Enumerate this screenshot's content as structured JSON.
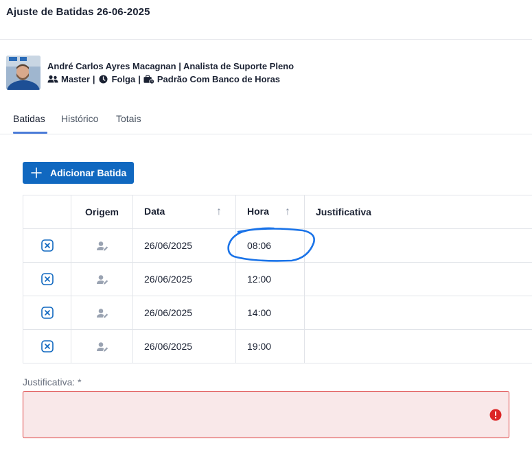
{
  "page": {
    "title": "Ajuste de Batidas 26-06-2025"
  },
  "user": {
    "name_role": "André Carlos Ayres Macagnan | Analista de Suporte Pleno",
    "group": "Master",
    "schedule": "Folga",
    "bank": "Padrão Com Banco de Horas",
    "separator": "|",
    "icons": [
      "users-icon",
      "clock-icon",
      "briefcase-icon"
    ]
  },
  "tabs": [
    {
      "label": "Batidas",
      "active": true
    },
    {
      "label": "Histórico",
      "active": false
    },
    {
      "label": "Totais",
      "active": false
    }
  ],
  "actions": {
    "add_label": "Adicionar Batida"
  },
  "table": {
    "columns": [
      "",
      "Origem",
      "Data",
      "Hora",
      "Justificativa"
    ],
    "sort_arrow": "↑",
    "rows": [
      {
        "date": "26/06/2025",
        "time": "08:06",
        "justification": ""
      },
      {
        "date": "26/06/2025",
        "time": "12:00",
        "justification": ""
      },
      {
        "date": "26/06/2025",
        "time": "14:00",
        "justification": ""
      },
      {
        "date": "26/06/2025",
        "time": "19:00",
        "justification": ""
      }
    ]
  },
  "form": {
    "justification_label": "Justificativa: *",
    "justification_value": ""
  },
  "colors": {
    "primary": "#1068c0",
    "error": "#dc3b3b",
    "error_bg": "#f9e8e9",
    "annotation": "#1a73e8",
    "tab_underline": "#4a7bd8"
  }
}
